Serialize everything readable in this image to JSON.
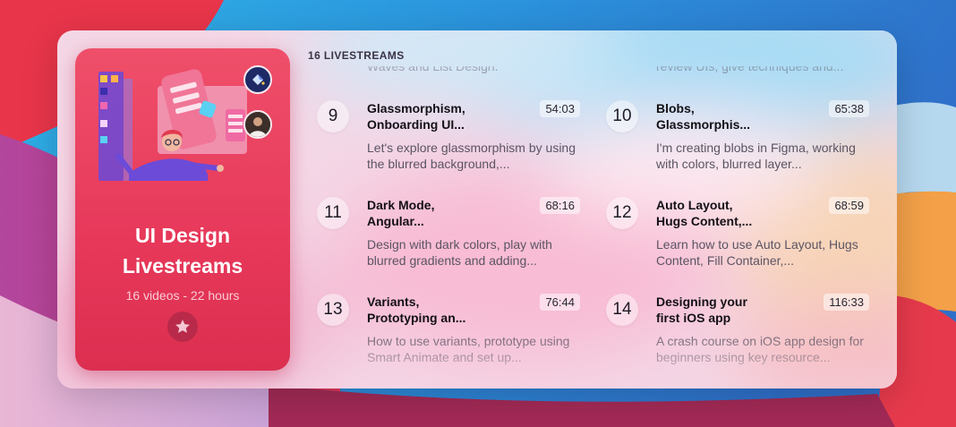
{
  "colors": {
    "accent": "#e7385a",
    "wallpaper_blue": "#3d86d6",
    "wallpaper_red": "#e8354a",
    "wallpaper_orange": "#f3a048"
  },
  "course": {
    "title": "UI Design\nLivestreams",
    "subtitle": "16 videos - 22 hours",
    "favorite_icon": "star-icon",
    "avatar_icons": [
      "paint-bucket-icon",
      "author-avatar"
    ]
  },
  "list": {
    "heading": "16 LIVESTREAMS",
    "partial_left": "Waves and List Design.",
    "partial_right": "review UIs, give techniques and...",
    "items": [
      {
        "num": "9",
        "title": "Glassmorphism,\nOnboarding UI...",
        "duration": "54:03",
        "desc": "Let's explore glassmorphism by using the blurred background,..."
      },
      {
        "num": "10",
        "title": "Blobs,\nGlassmorphis...",
        "duration": "65:38",
        "desc": "I'm creating blobs in Figma, working with colors, blurred layer..."
      },
      {
        "num": "11",
        "title": "Dark Mode,\nAngular...",
        "duration": "68:16",
        "desc": "Design with dark colors, play with blurred gradients and adding..."
      },
      {
        "num": "12",
        "title": "Auto Layout,\nHugs Content,...",
        "duration": "68:59",
        "desc": "Learn how to use Auto Layout, Hugs Content, Fill Container,..."
      },
      {
        "num": "13",
        "title": "Variants,\nPrototyping an...",
        "duration": "76:44",
        "desc": "How to use variants, prototype using Smart Animate and set up..."
      },
      {
        "num": "14",
        "title": "Designing your\nfirst iOS app",
        "duration": "116:33",
        "desc": "A crash course on iOS app design for beginners using key resource..."
      }
    ]
  }
}
